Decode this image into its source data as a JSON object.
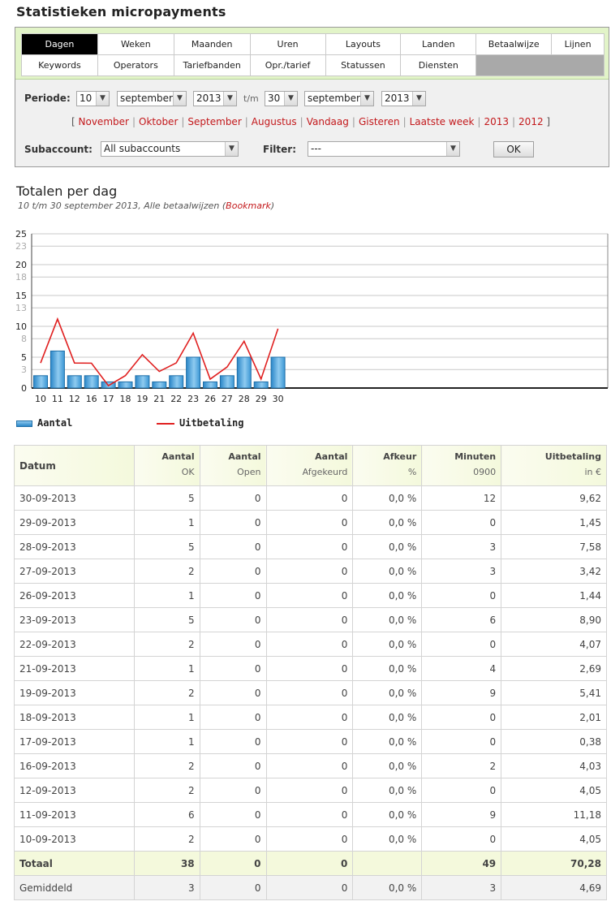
{
  "page_title": "Statistieken micropayments",
  "nav": {
    "row1": [
      "Dagen",
      "Weken",
      "Maanden",
      "Uren",
      "Layouts",
      "Landen",
      "Betaalwijze",
      "Lijnen"
    ],
    "row2": [
      "Keywords",
      "Operators",
      "Tariefbanden",
      "Opr./tarief",
      "Statussen",
      "Diensten"
    ],
    "active": "Dagen"
  },
  "filter": {
    "periode_label": "Periode:",
    "from_day": "10",
    "from_month": "september",
    "from_year": "2013",
    "tm_label": "t/m",
    "to_day": "30",
    "to_month": "september",
    "to_year": "2013",
    "quick_links": [
      "November",
      "Oktober",
      "September",
      "Augustus",
      "Vandaag",
      "Gisteren",
      "Laatste week",
      "2013",
      "2012"
    ],
    "bracket_open": "[",
    "bracket_close": "]",
    "subaccount_label": "Subaccount:",
    "subaccount_value": "All subaccounts",
    "filter_label": "Filter:",
    "filter_value": "---",
    "ok_label": "OK",
    "arrow": "▼"
  },
  "chart_section": {
    "heading": "Totalen per dag",
    "subtitle_text": "10 t/m 30 september 2013, Alle betaalwijzen (",
    "bookmark_label": "Bookmark",
    "subtitle_close": ")"
  },
  "chart_data": {
    "type": "bar",
    "categories": [
      "10",
      "11",
      "12",
      "16",
      "17",
      "18",
      "19",
      "21",
      "22",
      "23",
      "26",
      "27",
      "28",
      "29",
      "30"
    ],
    "series": [
      {
        "name": "Aantal",
        "type": "bar",
        "color": "#3a9ad9",
        "values": [
          2,
          6,
          2,
          2,
          1,
          1,
          2,
          1,
          2,
          5,
          1,
          2,
          5,
          1,
          5
        ]
      },
      {
        "name": "Uitbetaling",
        "type": "line",
        "color": "#e02020",
        "values": [
          4.05,
          11.18,
          4.05,
          4.03,
          0.38,
          2.01,
          5.41,
          2.69,
          4.07,
          8.9,
          1.44,
          3.42,
          7.58,
          1.45,
          9.62
        ]
      }
    ],
    "y_ticks": [
      "0",
      "3",
      "5",
      "8",
      "10",
      "13",
      "15",
      "18",
      "20",
      "23",
      "25"
    ],
    "ylim": [
      0,
      25
    ],
    "grid": true,
    "legend_position": "bottom-left"
  },
  "table": {
    "headers": [
      {
        "label": "Datum",
        "unit": ""
      },
      {
        "label": "Aantal",
        "unit": "OK"
      },
      {
        "label": "Aantal",
        "unit": "Open"
      },
      {
        "label": "Aantal",
        "unit": "Afgekeurd"
      },
      {
        "label": "Afkeur",
        "unit": "%"
      },
      {
        "label": "Minuten",
        "unit": "0900"
      },
      {
        "label": "Uitbetaling",
        "unit": "in €"
      }
    ],
    "rows": [
      [
        "30-09-2013",
        "5",
        "0",
        "0",
        "0,0 %",
        "12",
        "9,62"
      ],
      [
        "29-09-2013",
        "1",
        "0",
        "0",
        "0,0 %",
        "0",
        "1,45"
      ],
      [
        "28-09-2013",
        "5",
        "0",
        "0",
        "0,0 %",
        "3",
        "7,58"
      ],
      [
        "27-09-2013",
        "2",
        "0",
        "0",
        "0,0 %",
        "3",
        "3,42"
      ],
      [
        "26-09-2013",
        "1",
        "0",
        "0",
        "0,0 %",
        "0",
        "1,44"
      ],
      [
        "23-09-2013",
        "5",
        "0",
        "0",
        "0,0 %",
        "6",
        "8,90"
      ],
      [
        "22-09-2013",
        "2",
        "0",
        "0",
        "0,0 %",
        "0",
        "4,07"
      ],
      [
        "21-09-2013",
        "1",
        "0",
        "0",
        "0,0 %",
        "4",
        "2,69"
      ],
      [
        "19-09-2013",
        "2",
        "0",
        "0",
        "0,0 %",
        "9",
        "5,41"
      ],
      [
        "18-09-2013",
        "1",
        "0",
        "0",
        "0,0 %",
        "0",
        "2,01"
      ],
      [
        "17-09-2013",
        "1",
        "0",
        "0",
        "0,0 %",
        "0",
        "0,38"
      ],
      [
        "16-09-2013",
        "2",
        "0",
        "0",
        "0,0 %",
        "2",
        "4,03"
      ],
      [
        "12-09-2013",
        "2",
        "0",
        "0",
        "0,0 %",
        "0",
        "4,05"
      ],
      [
        "11-09-2013",
        "6",
        "0",
        "0",
        "0,0 %",
        "9",
        "11,18"
      ],
      [
        "10-09-2013",
        "2",
        "0",
        "0",
        "0,0 %",
        "0",
        "4,05"
      ]
    ],
    "total": [
      "Totaal",
      "38",
      "0",
      "0",
      "",
      "49",
      "70,28"
    ],
    "average": [
      "Gemiddeld",
      "3",
      "0",
      "0",
      "0,0 %",
      "3",
      "4,69"
    ]
  }
}
